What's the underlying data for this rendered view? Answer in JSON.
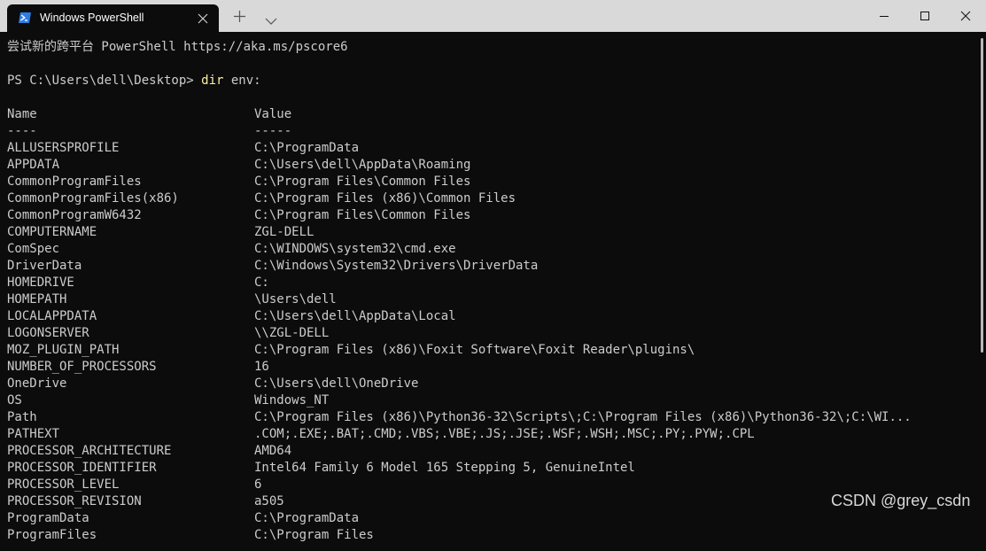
{
  "window": {
    "tab_title": "Windows PowerShell",
    "tab_icon": "powershell-icon",
    "colors": {
      "titlebar": "#d9d9d9",
      "terminal_bg": "#0c0c0c",
      "text": "#cccccc",
      "command": "#f9f1a5"
    }
  },
  "terminal": {
    "banner": "尝试新的跨平台 PowerShell https://aka.ms/pscore6",
    "prompt": "PS C:\\Users\\dell\\Desktop> ",
    "command": "dir",
    "command_arg": " env:",
    "header_name": "Name",
    "header_value": "Value",
    "sep_name": "----",
    "sep_value": "-----",
    "rows": [
      {
        "name": "ALLUSERSPROFILE",
        "value": "C:\\ProgramData"
      },
      {
        "name": "APPDATA",
        "value": "C:\\Users\\dell\\AppData\\Roaming"
      },
      {
        "name": "CommonProgramFiles",
        "value": "C:\\Program Files\\Common Files"
      },
      {
        "name": "CommonProgramFiles(x86)",
        "value": "C:\\Program Files (x86)\\Common Files"
      },
      {
        "name": "CommonProgramW6432",
        "value": "C:\\Program Files\\Common Files"
      },
      {
        "name": "COMPUTERNAME",
        "value": "ZGL-DELL"
      },
      {
        "name": "ComSpec",
        "value": "C:\\WINDOWS\\system32\\cmd.exe"
      },
      {
        "name": "DriverData",
        "value": "C:\\Windows\\System32\\Drivers\\DriverData"
      },
      {
        "name": "HOMEDRIVE",
        "value": "C:"
      },
      {
        "name": "HOMEPATH",
        "value": "\\Users\\dell"
      },
      {
        "name": "LOCALAPPDATA",
        "value": "C:\\Users\\dell\\AppData\\Local"
      },
      {
        "name": "LOGONSERVER",
        "value": "\\\\ZGL-DELL"
      },
      {
        "name": "MOZ_PLUGIN_PATH",
        "value": "C:\\Program Files (x86)\\Foxit Software\\Foxit Reader\\plugins\\"
      },
      {
        "name": "NUMBER_OF_PROCESSORS",
        "value": "16"
      },
      {
        "name": "OneDrive",
        "value": "C:\\Users\\dell\\OneDrive"
      },
      {
        "name": "OS",
        "value": "Windows_NT"
      },
      {
        "name": "Path",
        "value": "C:\\Program Files (x86)\\Python36-32\\Scripts\\;C:\\Program Files (x86)\\Python36-32\\;C:\\WI..."
      },
      {
        "name": "PATHEXT",
        "value": ".COM;.EXE;.BAT;.CMD;.VBS;.VBE;.JS;.JSE;.WSF;.WSH;.MSC;.PY;.PYW;.CPL"
      },
      {
        "name": "PROCESSOR_ARCHITECTURE",
        "value": "AMD64"
      },
      {
        "name": "PROCESSOR_IDENTIFIER",
        "value": "Intel64 Family 6 Model 165 Stepping 5, GenuineIntel"
      },
      {
        "name": "PROCESSOR_LEVEL",
        "value": "6"
      },
      {
        "name": "PROCESSOR_REVISION",
        "value": "a505"
      },
      {
        "name": "ProgramData",
        "value": "C:\\ProgramData"
      },
      {
        "name": "ProgramFiles",
        "value": "C:\\Program Files"
      }
    ]
  },
  "watermark": "CSDN @grey_csdn"
}
